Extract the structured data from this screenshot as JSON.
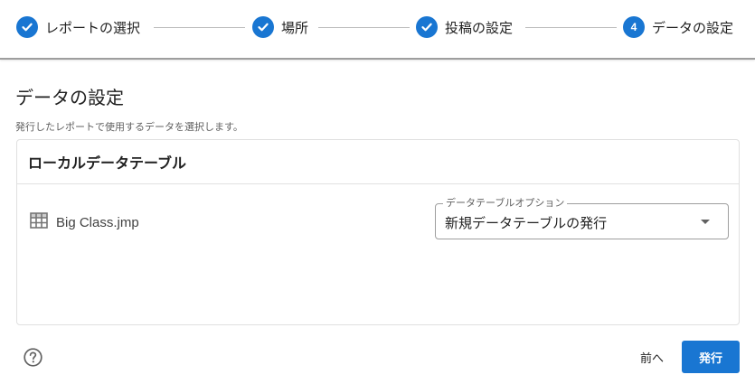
{
  "stepper": {
    "steps": [
      {
        "label": "レポートの選択",
        "state": "completed"
      },
      {
        "label": "場所",
        "state": "completed"
      },
      {
        "label": "投稿の設定",
        "state": "completed"
      },
      {
        "label": "データの設定",
        "state": "active",
        "number": "4"
      }
    ],
    "accent_color": "#1976d2"
  },
  "page": {
    "title": "データの設定",
    "description": "発行したレポートで使用するデータを選択します。"
  },
  "panel": {
    "title": "ローカルデータテーブル",
    "file": {
      "icon": "table-icon",
      "name": "Big Class.jmp"
    },
    "option": {
      "legend": "データテーブルオプション",
      "value": "新規データテーブルの発行"
    }
  },
  "footer": {
    "help_icon": "help-circle-icon",
    "back_label": "前へ",
    "publish_label": "発行"
  }
}
